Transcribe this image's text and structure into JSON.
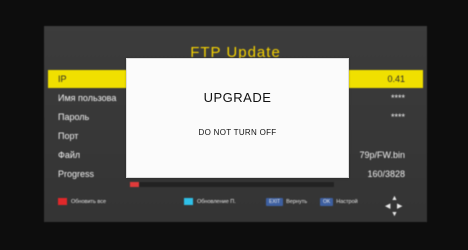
{
  "menu": {
    "title": "FTP Update",
    "rows": [
      {
        "label": "IP",
        "value": "0.41"
      },
      {
        "label": "Имя пользова",
        "value": "****"
      },
      {
        "label": "Пароль",
        "value": "****"
      },
      {
        "label": "Порт",
        "value": ""
      },
      {
        "label": "Файл",
        "value": "79p/FW.bin"
      },
      {
        "label": "Progress",
        "value": "160/3828"
      }
    ],
    "progress_fraction": 0.042
  },
  "legend": {
    "red_label": "Обновить все",
    "cyan_label": "Обновление П.",
    "exit_key": "EXIT",
    "back_label": "Вернуть",
    "ok_key": "OK",
    "ok_label": "Настрой"
  },
  "dialog": {
    "title": "UPGRADE",
    "message": "DO NOT TURN OFF"
  },
  "colors": {
    "highlight": "#f0e000",
    "title": "#f5d200",
    "progress": "#e03a3a",
    "red_key": "#e0282a",
    "cyan_key": "#2fc0e8"
  },
  "icons": {
    "red_key": "red-key-icon",
    "cyan_key": "cyan-key-icon",
    "navigation": "dpad-arrows-icon"
  }
}
